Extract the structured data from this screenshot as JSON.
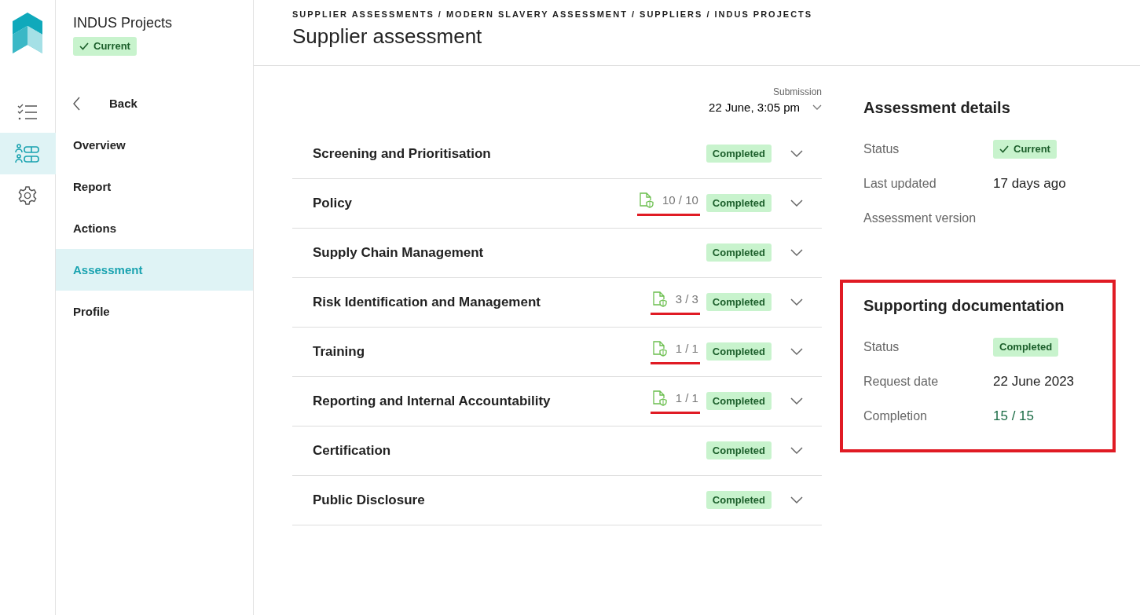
{
  "rail": [
    {
      "kind": "checklist",
      "selected": false
    },
    {
      "kind": "people-list",
      "selected": true
    },
    {
      "kind": "settings",
      "selected": false
    }
  ],
  "supplier": {
    "name": "INDUS Projects",
    "status": "Current"
  },
  "nav": {
    "back": "Back",
    "items": [
      {
        "label": "Overview",
        "selected": false
      },
      {
        "label": "Report",
        "selected": false
      },
      {
        "label": "Actions",
        "selected": false
      },
      {
        "label": "Assessment",
        "selected": true
      },
      {
        "label": "Profile",
        "selected": false
      }
    ]
  },
  "breadcrumb": "SUPPLIER ASSESSMENTS / MODERN SLAVERY ASSESSMENT / SUPPLIERS / INDUS PROJECTS",
  "page_title": "Supplier assessment",
  "submission": {
    "label": "Submission",
    "value": "22 June, 3:05 pm"
  },
  "sections": [
    {
      "title": "Screening and Prioritisation",
      "status": "Completed",
      "expanded": false
    },
    {
      "title": "Policy",
      "docs": "10 / 10",
      "underlined": true,
      "status": "Completed",
      "expanded": false
    },
    {
      "title": "Supply Chain Management",
      "status": "Completed",
      "expanded": false
    },
    {
      "title": "Risk Identification and Management",
      "docs": "3 / 3",
      "underlined": true,
      "status": "Completed",
      "expanded": false
    },
    {
      "title": "Training",
      "docs": "1 / 1",
      "underlined": true,
      "status": "Completed",
      "expanded": false
    },
    {
      "title": "Reporting and Internal Accountability",
      "docs": "1 / 1",
      "underlined": true,
      "status": "Completed",
      "expanded": false
    },
    {
      "title": "Certification",
      "status": "Completed",
      "expanded": false
    },
    {
      "title": "Public Disclosure",
      "status": "Completed",
      "expanded": false
    }
  ],
  "panels": [
    {
      "title": "Assessment details",
      "highlighted": false,
      "rows": [
        {
          "label": "Status",
          "kind": "badge",
          "value": "Current"
        },
        {
          "label": "Last updated",
          "kind": "text",
          "value": "17 days ago"
        },
        {
          "label": "Assessment version"
        }
      ]
    },
    {
      "title": "Supporting documentation",
      "highlighted": true,
      "rows": [
        {
          "label": "Status",
          "kind": "badge",
          "value": "Completed"
        },
        {
          "label": "Request date",
          "kind": "text",
          "value": "22 June 2023"
        },
        {
          "label": "Completion",
          "kind": "count",
          "value": "15 / 15"
        }
      ]
    }
  ]
}
